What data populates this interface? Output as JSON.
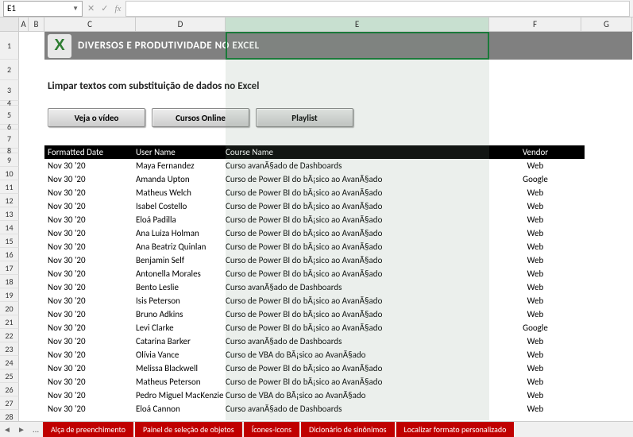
{
  "namebox": "E1",
  "banner_title": "DIVERSOS E PRODUTIVIDADE NO EXCEL",
  "subtitle": "Limpar textos com substituição de dados no Excel",
  "buttons": {
    "b1": "Veja o vídeo",
    "b2": "Cursos Online",
    "b3": "Playlist"
  },
  "columns": {
    "A": "A",
    "B": "B",
    "C": "C",
    "D": "D",
    "E": "E",
    "F": "F",
    "G": "G"
  },
  "headers": {
    "h1": "Formatted Date",
    "h2": "User Name",
    "h3": "Course Name",
    "h4": "Vendor"
  },
  "rows": [
    {
      "d": "Nov 30 '20",
      "u": "Maya Fernandez",
      "c": "Curso avanÃ§ado de Dashboards",
      "v": "Web"
    },
    {
      "d": "Nov 30 '20",
      "u": "Amanda Upton",
      "c": "Curso de Power BI do bÃ¡sico ao AvanÃ§ado",
      "v": "Google"
    },
    {
      "d": "Nov 30 '20",
      "u": "Matheus Welch",
      "c": "Curso de Power BI do bÃ¡sico ao AvanÃ§ado",
      "v": "Web"
    },
    {
      "d": "Nov 30 '20",
      "u": "Isabel Costello",
      "c": "Curso de Power BI do bÃ¡sico ao AvanÃ§ado",
      "v": "Web"
    },
    {
      "d": "Nov 30 '20",
      "u": "Eloá Padilla",
      "c": "Curso de Power BI do bÃ¡sico ao AvanÃ§ado",
      "v": "Web"
    },
    {
      "d": "Nov 30 '20",
      "u": "Ana Luiza Holman",
      "c": "Curso de Power BI do bÃ¡sico ao AvanÃ§ado",
      "v": "Web"
    },
    {
      "d": "Nov 30 '20",
      "u": "Ana Beatriz Quinlan",
      "c": "Curso de Power BI do bÃ¡sico ao AvanÃ§ado",
      "v": "Web"
    },
    {
      "d": "Nov 30 '20",
      "u": "Benjamin Self",
      "c": "Curso de Power BI do bÃ¡sico ao AvanÃ§ado",
      "v": "Web"
    },
    {
      "d": "Nov 30 '20",
      "u": "Antonella Morales",
      "c": "Curso de Power BI do bÃ¡sico ao AvanÃ§ado",
      "v": "Web"
    },
    {
      "d": "Nov 30 '20",
      "u": "Bento Leslie",
      "c": "Curso avanÃ§ado de Dashboards",
      "v": "Web"
    },
    {
      "d": "Nov 30 '20",
      "u": "Isis Peterson",
      "c": "Curso de Power BI do bÃ¡sico ao AvanÃ§ado",
      "v": "Web"
    },
    {
      "d": "Nov 30 '20",
      "u": "Bruno Adkins",
      "c": "Curso de Power BI do bÃ¡sico ao AvanÃ§ado",
      "v": "Web"
    },
    {
      "d": "Nov 30 '20",
      "u": "Levi Clarke",
      "c": "Curso de Power BI do bÃ¡sico ao AvanÃ§ado",
      "v": "Google"
    },
    {
      "d": "Nov 30 '20",
      "u": "Catarina Barker",
      "c": "Curso avanÃ§ado de Dashboards",
      "v": "Web"
    },
    {
      "d": "Nov 30 '20",
      "u": "Olívia Vance",
      "c": "Curso de VBA do BÃ¡sico ao AvanÃ§ado",
      "v": "Web"
    },
    {
      "d": "Nov 30 '20",
      "u": "Melissa Blackwell",
      "c": "Curso de Power BI do bÃ¡sico ao AvanÃ§ado",
      "v": "Web"
    },
    {
      "d": "Nov 30 '20",
      "u": "Matheus Peterson",
      "c": "Curso de Power BI do bÃ¡sico ao AvanÃ§ado",
      "v": "Web"
    },
    {
      "d": "Nov 30 '20",
      "u": "Pedro Miguel MacKenzie",
      "c": "Curso de VBA do BÃ¡sico ao AvanÃ§ado",
      "v": "Web"
    },
    {
      "d": "Nov 30 '20",
      "u": "Eloá Cannon",
      "c": "Curso avanÃ§ado de Dashboards",
      "v": "Web"
    }
  ],
  "row_nums": [
    "1",
    "2",
    "3",
    "4",
    "5",
    "6",
    "7",
    "8",
    "9",
    "10",
    "11",
    "12",
    "13",
    "14",
    "15",
    "16",
    "17",
    "18",
    "19",
    "20",
    "21",
    "22",
    "23",
    "24",
    "25",
    "26",
    "27",
    "28"
  ],
  "tabs": {
    "t1": "Alça de preenchimento",
    "t2": "Painel de seleção de objetos",
    "t3": "Ícones-Icons",
    "t4": "Dicionário de sinônimos",
    "t5": "Localizar formato personalizado"
  }
}
